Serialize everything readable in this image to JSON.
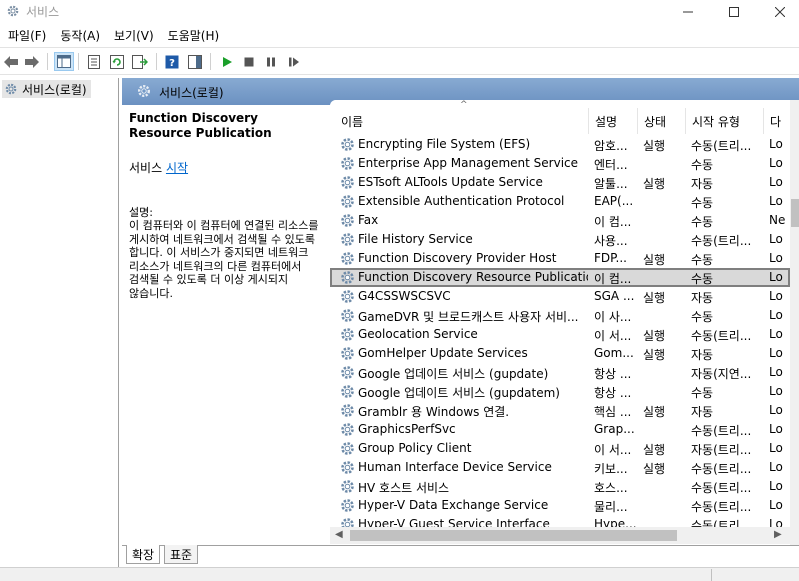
{
  "window": {
    "title": "서비스"
  },
  "menu": [
    {
      "label": "파일(F)"
    },
    {
      "label": "동작(A)"
    },
    {
      "label": "보기(V)"
    },
    {
      "label": "도움말(H)"
    }
  ],
  "tree": {
    "root_label": "서비스(로컬)"
  },
  "pane": {
    "header_label": "서비스(로컬)"
  },
  "details": {
    "service_name": "Function Discovery Resource Publication",
    "start_prefix": "서비스",
    "start_link": "시작",
    "description_label": "설명:",
    "description_text": "이 컴퓨터와 이 컴퓨터에 연결된 리소스를 게시하여 네트워크에서 검색될 수 있도록 합니다. 이 서비스가 중지되면 네트워크 리소스가 네트워크의 다른 컴퓨터에서 검색될 수 있도록 더 이상 게시되지 않습니다."
  },
  "columns": {
    "name": "이름",
    "description": "설명",
    "status": "상태",
    "startup": "시작 유형",
    "logon": "다"
  },
  "services": [
    {
      "name": "Encrypting File System (EFS)",
      "desc": "암호...",
      "status": "실행",
      "startup": "수동(트리...",
      "logon": "Lo"
    },
    {
      "name": "Enterprise App Management Service",
      "desc": "엔터...",
      "status": "",
      "startup": "수동",
      "logon": "Lo"
    },
    {
      "name": "ESTsoft ALTools Update Service",
      "desc": "알툴...",
      "status": "실행",
      "startup": "자동",
      "logon": "Lo"
    },
    {
      "name": "Extensible Authentication Protocol",
      "desc": "EAP(...",
      "status": "",
      "startup": "수동",
      "logon": "Lo"
    },
    {
      "name": "Fax",
      "desc": "이 컴...",
      "status": "",
      "startup": "수동",
      "logon": "Ne"
    },
    {
      "name": "File History Service",
      "desc": "사용...",
      "status": "",
      "startup": "수동(트리...",
      "logon": "Lo"
    },
    {
      "name": "Function Discovery Provider Host",
      "desc": "FDP...",
      "status": "실행",
      "startup": "수동",
      "logon": "Lo"
    },
    {
      "name": "Function Discovery Resource Publication",
      "desc": "이 컴...",
      "status": "",
      "startup": "수동",
      "logon": "Lo",
      "selected": true
    },
    {
      "name": "G4CSSWSCSVC",
      "desc": "SGA ...",
      "status": "실행",
      "startup": "자동",
      "logon": "Lo"
    },
    {
      "name": "GameDVR 및 브로드캐스트 사용자 서비...",
      "desc": "이 사...",
      "status": "",
      "startup": "수동",
      "logon": "Lo"
    },
    {
      "name": "Geolocation Service",
      "desc": "이 서...",
      "status": "실행",
      "startup": "수동(트리...",
      "logon": "Lo"
    },
    {
      "name": "GomHelper Update Services",
      "desc": "Gom...",
      "status": "실행",
      "startup": "자동",
      "logon": "Lo"
    },
    {
      "name": "Google 업데이트 서비스 (gupdate)",
      "desc": "항상 ...",
      "status": "",
      "startup": "자동(지연...",
      "logon": "Lo"
    },
    {
      "name": "Google 업데이트 서비스 (gupdatem)",
      "desc": "항상 ...",
      "status": "",
      "startup": "수동",
      "logon": "Lo"
    },
    {
      "name": "Gramblr 용 Windows 연결.",
      "desc": "핵심 ...",
      "status": "실행",
      "startup": "자동",
      "logon": "Lo"
    },
    {
      "name": "GraphicsPerfSvc",
      "desc": "Grap...",
      "status": "",
      "startup": "수동(트리...",
      "logon": "Lo"
    },
    {
      "name": "Group Policy Client",
      "desc": "이 서...",
      "status": "실행",
      "startup": "자동(트리...",
      "logon": "Lo"
    },
    {
      "name": "Human Interface Device Service",
      "desc": "키보...",
      "status": "실행",
      "startup": "수동(트리...",
      "logon": "Lo"
    },
    {
      "name": "HV 호스트 서비스",
      "desc": "호스...",
      "status": "",
      "startup": "수동(트리...",
      "logon": "Lo"
    },
    {
      "name": "Hyper-V Data Exchange Service",
      "desc": "물리...",
      "status": "",
      "startup": "수동(트리...",
      "logon": "Lo"
    },
    {
      "name": "Hyper-V Guest Service Interface",
      "desc": "Hype...",
      "status": "",
      "startup": "수동(트리...",
      "logon": "Lo"
    }
  ],
  "tabs": [
    {
      "label": "확장"
    },
    {
      "label": "표준"
    }
  ],
  "colors": {
    "header_blue": "#7399c6",
    "selection_gray": "#d9d9d9",
    "link_blue": "#0066cc",
    "play_green": "#1a9f2a"
  },
  "icons": [
    "gear-icon",
    "back-arrow-icon",
    "forward-arrow-icon",
    "console-tree-icon",
    "properties-icon",
    "refresh-icon",
    "export-list-icon",
    "help-icon",
    "show-hide-icon",
    "start-icon",
    "stop-icon",
    "pause-icon",
    "restart-icon"
  ]
}
